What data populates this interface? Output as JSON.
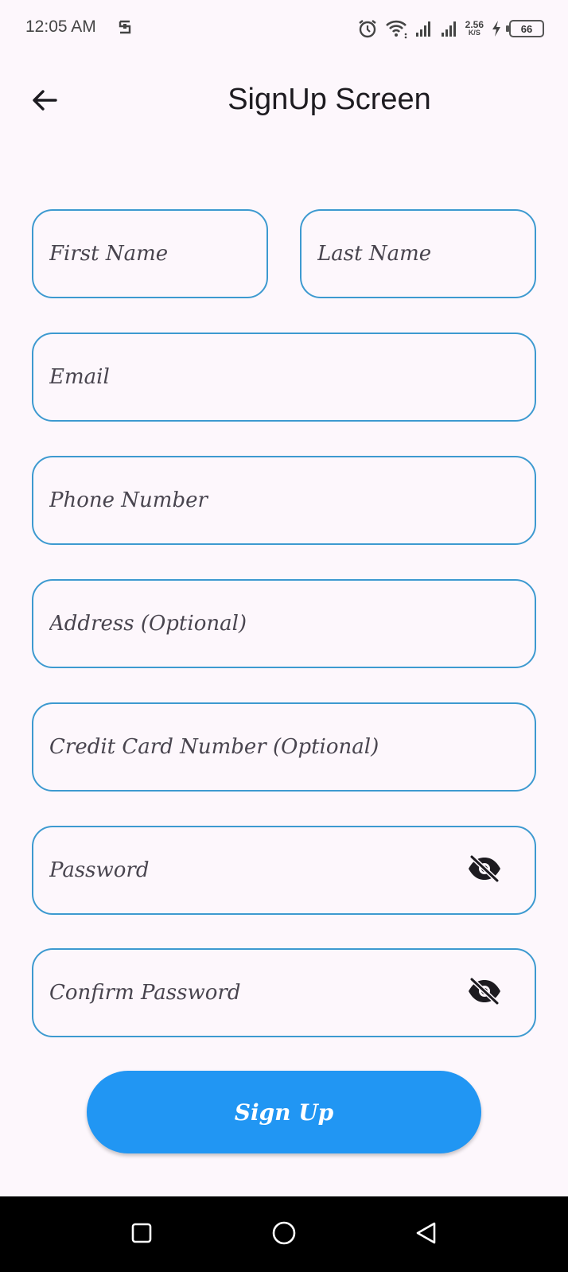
{
  "status_bar": {
    "time": "12:05 AM",
    "net_speed_value": "2.56",
    "net_speed_unit": "K/S",
    "battery_level": "66",
    "icons": [
      "s-icon",
      "alarm-icon",
      "wifi-icon",
      "signal-icon",
      "signal-icon",
      "charging-icon",
      "battery-icon"
    ]
  },
  "app_bar": {
    "title": "SignUp Screen",
    "back_icon": "arrow-left-icon"
  },
  "form": {
    "first_name": {
      "placeholder": "First Name",
      "value": ""
    },
    "last_name": {
      "placeholder": "Last Name",
      "value": ""
    },
    "email": {
      "placeholder": "Email",
      "value": ""
    },
    "phone": {
      "placeholder": "Phone Number",
      "value": ""
    },
    "address": {
      "placeholder": "Address (Optional)",
      "value": ""
    },
    "credit_card": {
      "placeholder": "Credit Card Number (Optional)",
      "value": ""
    },
    "password": {
      "placeholder": "Password",
      "value": "",
      "toggle_icon": "eye-off-icon"
    },
    "confirm_password": {
      "placeholder": "Confirm Password",
      "value": "",
      "toggle_icon": "eye-off-icon"
    },
    "submit_label": "Sign Up"
  },
  "colors": {
    "background": "#fdf7fc",
    "field_border": "#3d9ad0",
    "button": "#2196f3",
    "button_text": "#ffffff",
    "nav_bar": "#000000"
  },
  "nav_bar": {
    "items": [
      "recents-square-icon",
      "home-circle-icon",
      "back-triangle-icon"
    ]
  }
}
